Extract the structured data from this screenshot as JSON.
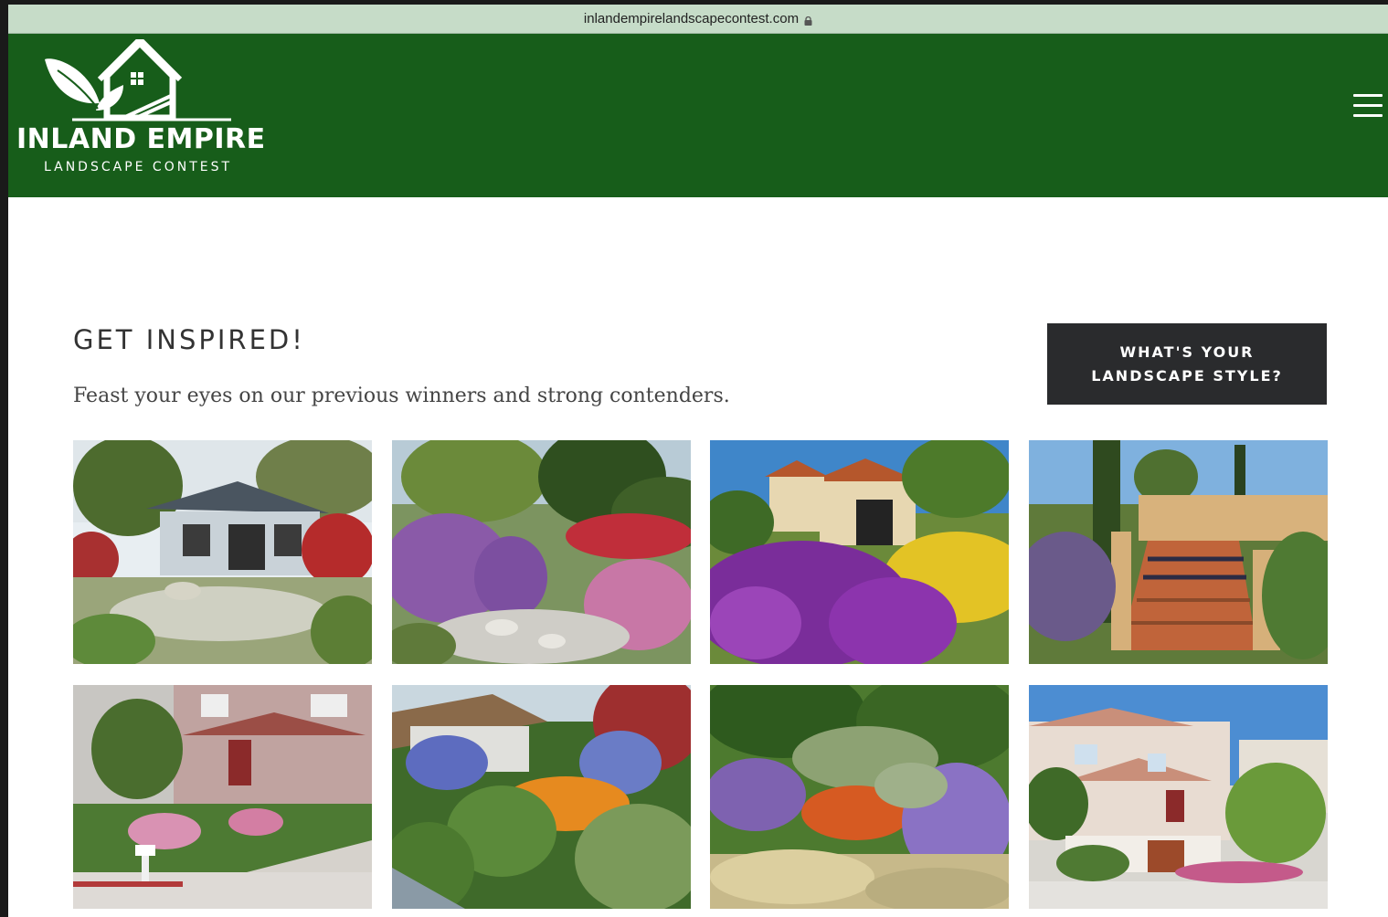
{
  "browser": {
    "url": "inlandempirelandscapecontest.com"
  },
  "header": {
    "logo_title": "INLAND EMPIRE",
    "logo_subtitle": "LANDSCAPE CONTEST",
    "background_color": "#175d1a",
    "menu_icon": "hamburger-icon"
  },
  "main": {
    "heading": "GET INSPIRED!",
    "subtitle": "Feast your eyes on our previous winners and strong contenders.",
    "cta_label": "WHAT'S YOUR\nLANDSCAPE STYLE?",
    "gallery": [
      {
        "name": "gallery-photo-craftsman-house-garden"
      },
      {
        "name": "gallery-photo-purple-sage-rock-garden"
      },
      {
        "name": "gallery-photo-spanish-house-purple-flowers"
      },
      {
        "name": "gallery-photo-terracotta-stairs-garden"
      },
      {
        "name": "gallery-photo-pink-house-front-yard"
      },
      {
        "name": "gallery-photo-lush-cottage-garden"
      },
      {
        "name": "gallery-photo-wildflower-meadow"
      },
      {
        "name": "gallery-photo-white-house-courtyard"
      }
    ]
  }
}
